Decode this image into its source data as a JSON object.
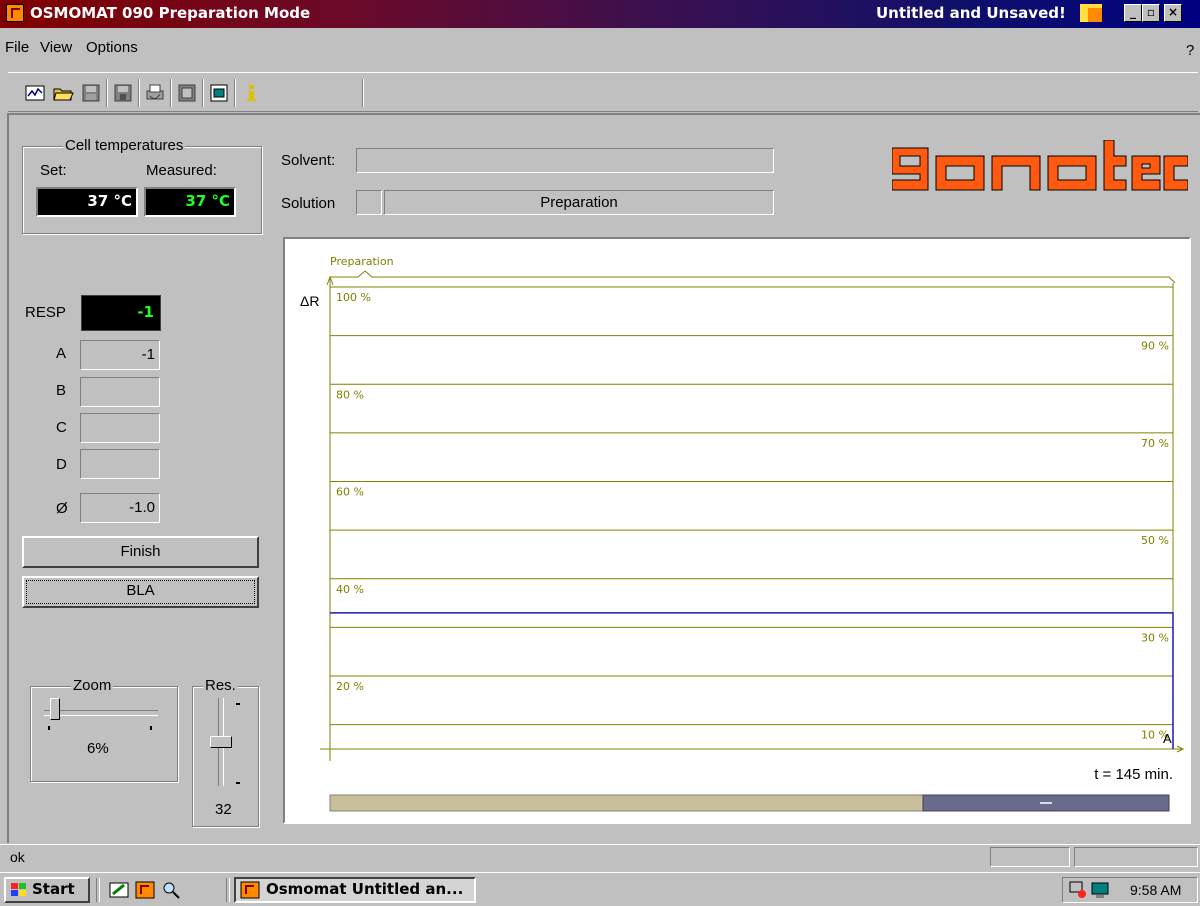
{
  "window": {
    "title": "OSMOMAT 090 Preparation Mode",
    "status_title": "Untitled and Unsaved!",
    "minimize": "_",
    "maximize": "▫",
    "close": "×"
  },
  "menu": {
    "items": [
      "File",
      "View",
      "Options"
    ],
    "help": "?"
  },
  "toolbar": {
    "icons": [
      "chart-icon",
      "open-folder-icon",
      "save-icon",
      "save-as-icon",
      "print-icon",
      "display-icon",
      "window-icon",
      "info-icon"
    ]
  },
  "cell_temperatures": {
    "title": "Cell temperatures",
    "set_label": "Set:",
    "measured_label": "Measured:",
    "set_value": "37 °C",
    "measured_value": "37 °C"
  },
  "solvent": {
    "label": "Solvent:",
    "value": ""
  },
  "solution": {
    "label": "Solution",
    "code": "",
    "value": "Preparation"
  },
  "logo": "gonotec",
  "readings": {
    "resp_label": "RESP",
    "resp_value": "-1",
    "a_label": "A",
    "a_value": "-1",
    "b_label": "B",
    "b_value": "",
    "c_label": "C",
    "c_value": "",
    "d_label": "D",
    "d_value": "",
    "avg_label": "Ø",
    "avg_value": "-1.0"
  },
  "buttons": {
    "finish": "Finish",
    "bla": "BLA"
  },
  "zoom": {
    "title": "Zoom",
    "value": "6%",
    "level": 0.06
  },
  "res": {
    "title": "Res.",
    "value": "32",
    "level": 0.5
  },
  "chart_data": {
    "type": "line",
    "phase_label": "Preparation",
    "ylabel": "ΔR",
    "ticks": [
      "100 %",
      "90 %",
      "80 %",
      "70 %",
      "60 %",
      "50 %",
      "40 %",
      "30 %",
      "20 %",
      "10 %"
    ],
    "ylim": [
      5,
      100
    ],
    "series": [
      {
        "name": "A",
        "color": "#1a1ab4",
        "points": [
          [
            0,
            33
          ],
          [
            145,
            33
          ],
          [
            145,
            5
          ]
        ]
      }
    ],
    "xlim": [
      0,
      145
    ],
    "time_readout": "t = 145 min.",
    "scroll_position": 1.0
  },
  "colors": {
    "axis": "#808000",
    "logo": "#ff5a10",
    "resp_text": "#20ff20"
  },
  "statusbar": {
    "text": "ok"
  },
  "taskbar": {
    "start": "Start",
    "task": "Osmomat Untitled an...",
    "clock": "9:58 AM"
  }
}
